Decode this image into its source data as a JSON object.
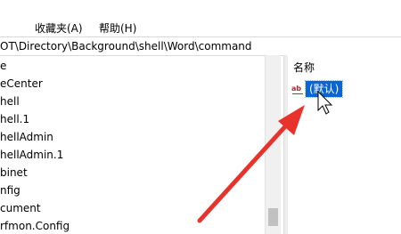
{
  "menubar": {
    "items": [
      {
        "label": "收藏夹(A)"
      },
      {
        "label": "帮助(H)"
      }
    ]
  },
  "address": {
    "path": "OT\\Directory\\Background\\shell\\Word\\command"
  },
  "tree": {
    "items": [
      {
        "label": "e"
      },
      {
        "label": "eCenter"
      },
      {
        "label": "hell"
      },
      {
        "label": "hell.1"
      },
      {
        "label": "hellAdmin"
      },
      {
        "label": "hellAdmin.1"
      },
      {
        "label": "binet"
      },
      {
        "label": "nfig"
      },
      {
        "label": "cument"
      },
      {
        "label": "rfmon.Config"
      }
    ]
  },
  "values_pane": {
    "column_name": "名称",
    "rows": [
      {
        "icon": "string-value-icon",
        "name": "(默认)"
      }
    ]
  },
  "annotation": {
    "color": "#e8322c"
  }
}
